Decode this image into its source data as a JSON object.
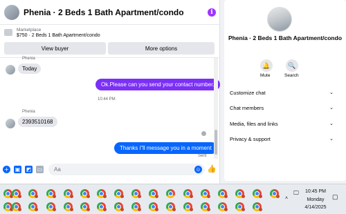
{
  "header": {
    "title": "Phenia · 2 Beds 1 Bath Apartment/condo",
    "info_icon": "info-icon"
  },
  "marketplace": {
    "label": "Marketplace",
    "listing": "$750 · 2 Beds 1 Bath Apartment/condo",
    "view_buyer": "View buyer",
    "more_options": "More options"
  },
  "messages": {
    "first": {
      "sender": "Phenia",
      "text": "Today"
    },
    "outgoing1": "Ok.Please can you send your contact number.",
    "time": "10:44 PM",
    "second": {
      "sender": "Phenia",
      "text": "2393510168"
    },
    "outgoing2": "Thanks i\"ll message you in a moment",
    "status": "Sent"
  },
  "composer": {
    "placeholder": "Aa"
  },
  "side": {
    "title": "Phenia · 2 Beds 1 Bath Apartment/condo",
    "mute": "Mute",
    "search": "Search",
    "sections": [
      "Customize chat",
      "Chat members",
      "Media, files and links",
      "Privacy & support"
    ]
  },
  "taskbar": {
    "time": "10:45 PM",
    "day": "Monday",
    "date": "4/14/2025"
  },
  "colors": {
    "accent_purple": "#7b2ff7",
    "accent_blue": "#0866ff",
    "bubble_in": "#e4e6eb"
  }
}
